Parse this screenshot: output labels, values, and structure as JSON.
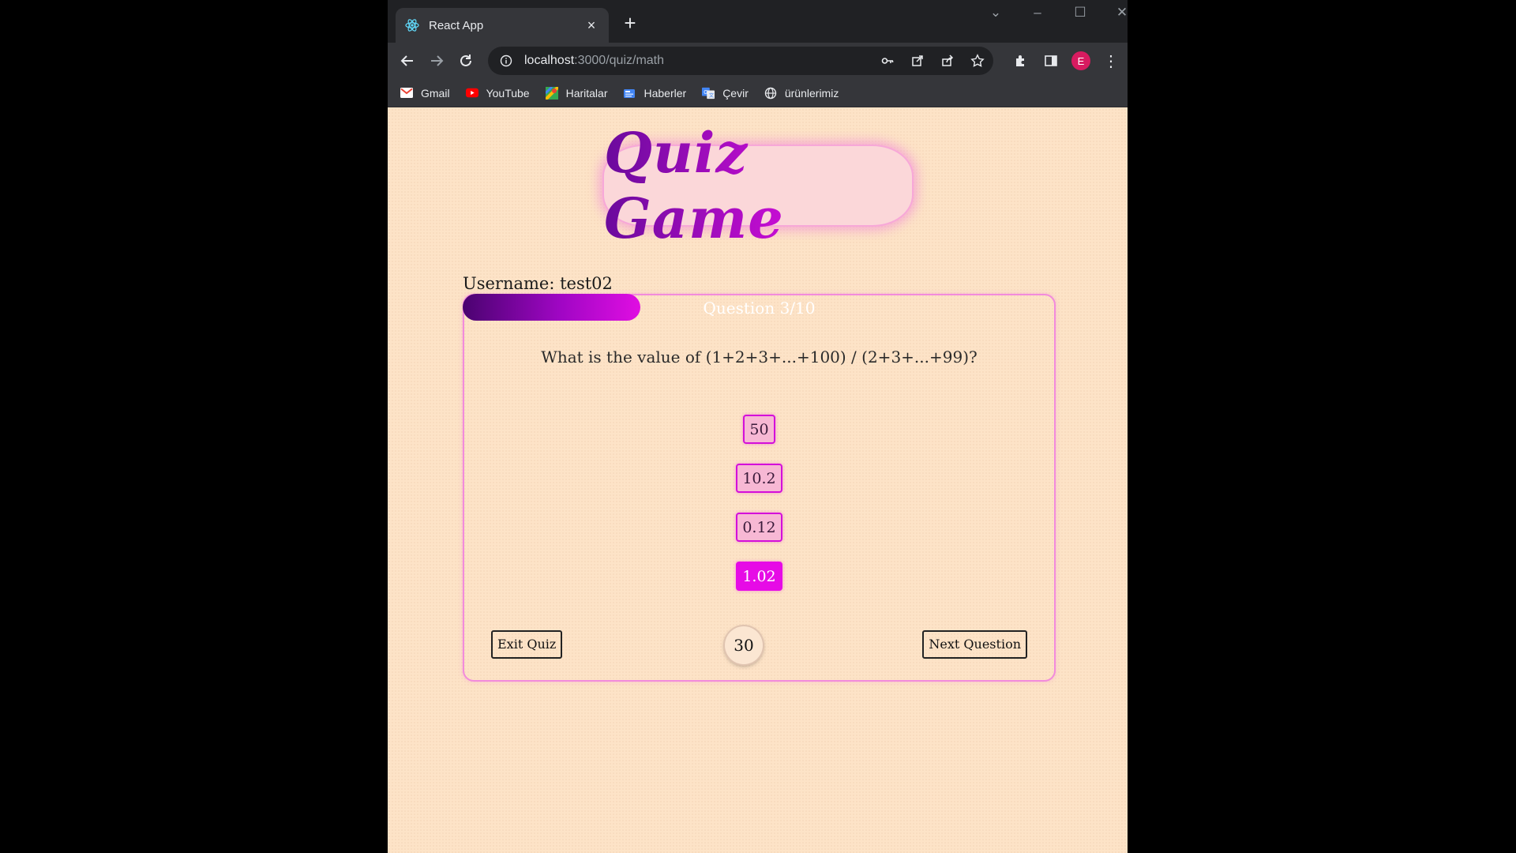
{
  "browser": {
    "tab_title": "React App",
    "url_host": "localhost",
    "url_path": ":3000/quiz/math",
    "profile_initial": "E",
    "bookmarks": [
      {
        "label": "Gmail",
        "icon": "gmail-icon"
      },
      {
        "label": "YouTube",
        "icon": "youtube-icon"
      },
      {
        "label": "Haritalar",
        "icon": "maps-icon"
      },
      {
        "label": "Haberler",
        "icon": "news-icon"
      },
      {
        "label": "Çevir",
        "icon": "translate-icon"
      },
      {
        "label": "ürünlerimiz",
        "icon": "globe-icon"
      }
    ]
  },
  "app": {
    "logo_text": "Quiz Game",
    "username_label": "Username: test02",
    "progress": {
      "current": 3,
      "total": 10
    },
    "question_counter": "Question 3/10",
    "question": "What is the value of (1+2+3+...+100) / (2+3+...+99)?",
    "answers": [
      "50",
      "10.2",
      "0.12",
      "1.02"
    ],
    "selected_answer": "1.02",
    "exit_label": "Exit Quiz",
    "next_label": "Next Question",
    "timer": "30"
  },
  "colors": {
    "page_bg": "#fde3c7",
    "accent": "#e60be6",
    "card_border": "#f28bdc",
    "answer_bg": "#f7b8d4"
  }
}
